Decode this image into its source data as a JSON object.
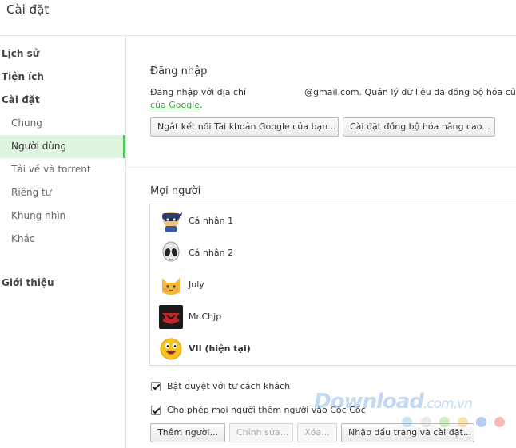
{
  "header": {
    "title": "Cài đặt"
  },
  "sidebar": {
    "items": [
      {
        "label": "Lịch sử"
      },
      {
        "label": "Tiện ích"
      },
      {
        "label": "Cài đặt"
      },
      {
        "label": "Chung"
      },
      {
        "label": "Người dùng"
      },
      {
        "label": "Tải về và torrent"
      },
      {
        "label": "Riêng tư"
      },
      {
        "label": "Khung nhìn"
      },
      {
        "label": "Khác"
      },
      {
        "label": "Giới thiệu"
      }
    ]
  },
  "signin": {
    "title": "Đăng nhập",
    "desc_prefix": "Đăng nhập với địa chỉ",
    "desc_email": "@gmail.com. Quản lý dữ liệu đã đồng bộ hóa của",
    "link": "của Google",
    "link_suffix": ".",
    "disconnect_button": "Ngắt kết nối Tài khoản Google của bạn...",
    "advanced_sync_button": "Cài đặt đồng bộ hóa nâng cao..."
  },
  "people": {
    "title": "Mọi người",
    "list": [
      {
        "name": "Cá nhân 1",
        "avatar": "ninja-avatar-icon",
        "current": false
      },
      {
        "name": "Cá nhân 2",
        "avatar": "alien-avatar-icon",
        "current": false
      },
      {
        "name": "July",
        "avatar": "cat-avatar-icon",
        "current": false
      },
      {
        "name": "Mr.Chjp",
        "avatar": "red-logo-avatar-icon",
        "current": false
      },
      {
        "name": "VII (hiện tại)",
        "avatar": "smiley-avatar-icon",
        "current": true
      }
    ],
    "guest_checkbox": {
      "label": "Bật duyệt với tư cách khách",
      "checked": true
    },
    "allow_add_checkbox": {
      "label": "Cho phép mọi người thêm người vào Cốc Cốc",
      "checked": true
    },
    "buttons": {
      "add": "Thêm người...",
      "edit": "Chỉnh sửa...",
      "delete": "Xóa...",
      "import": "Nhập dấu trang và cài đặt..."
    }
  },
  "watermark": {
    "text": "Download",
    "suffix": ".com.vn"
  },
  "colors": {
    "accent": "#4fc45a",
    "active_bg": "#dff5e0",
    "link": "#4a9e52"
  }
}
